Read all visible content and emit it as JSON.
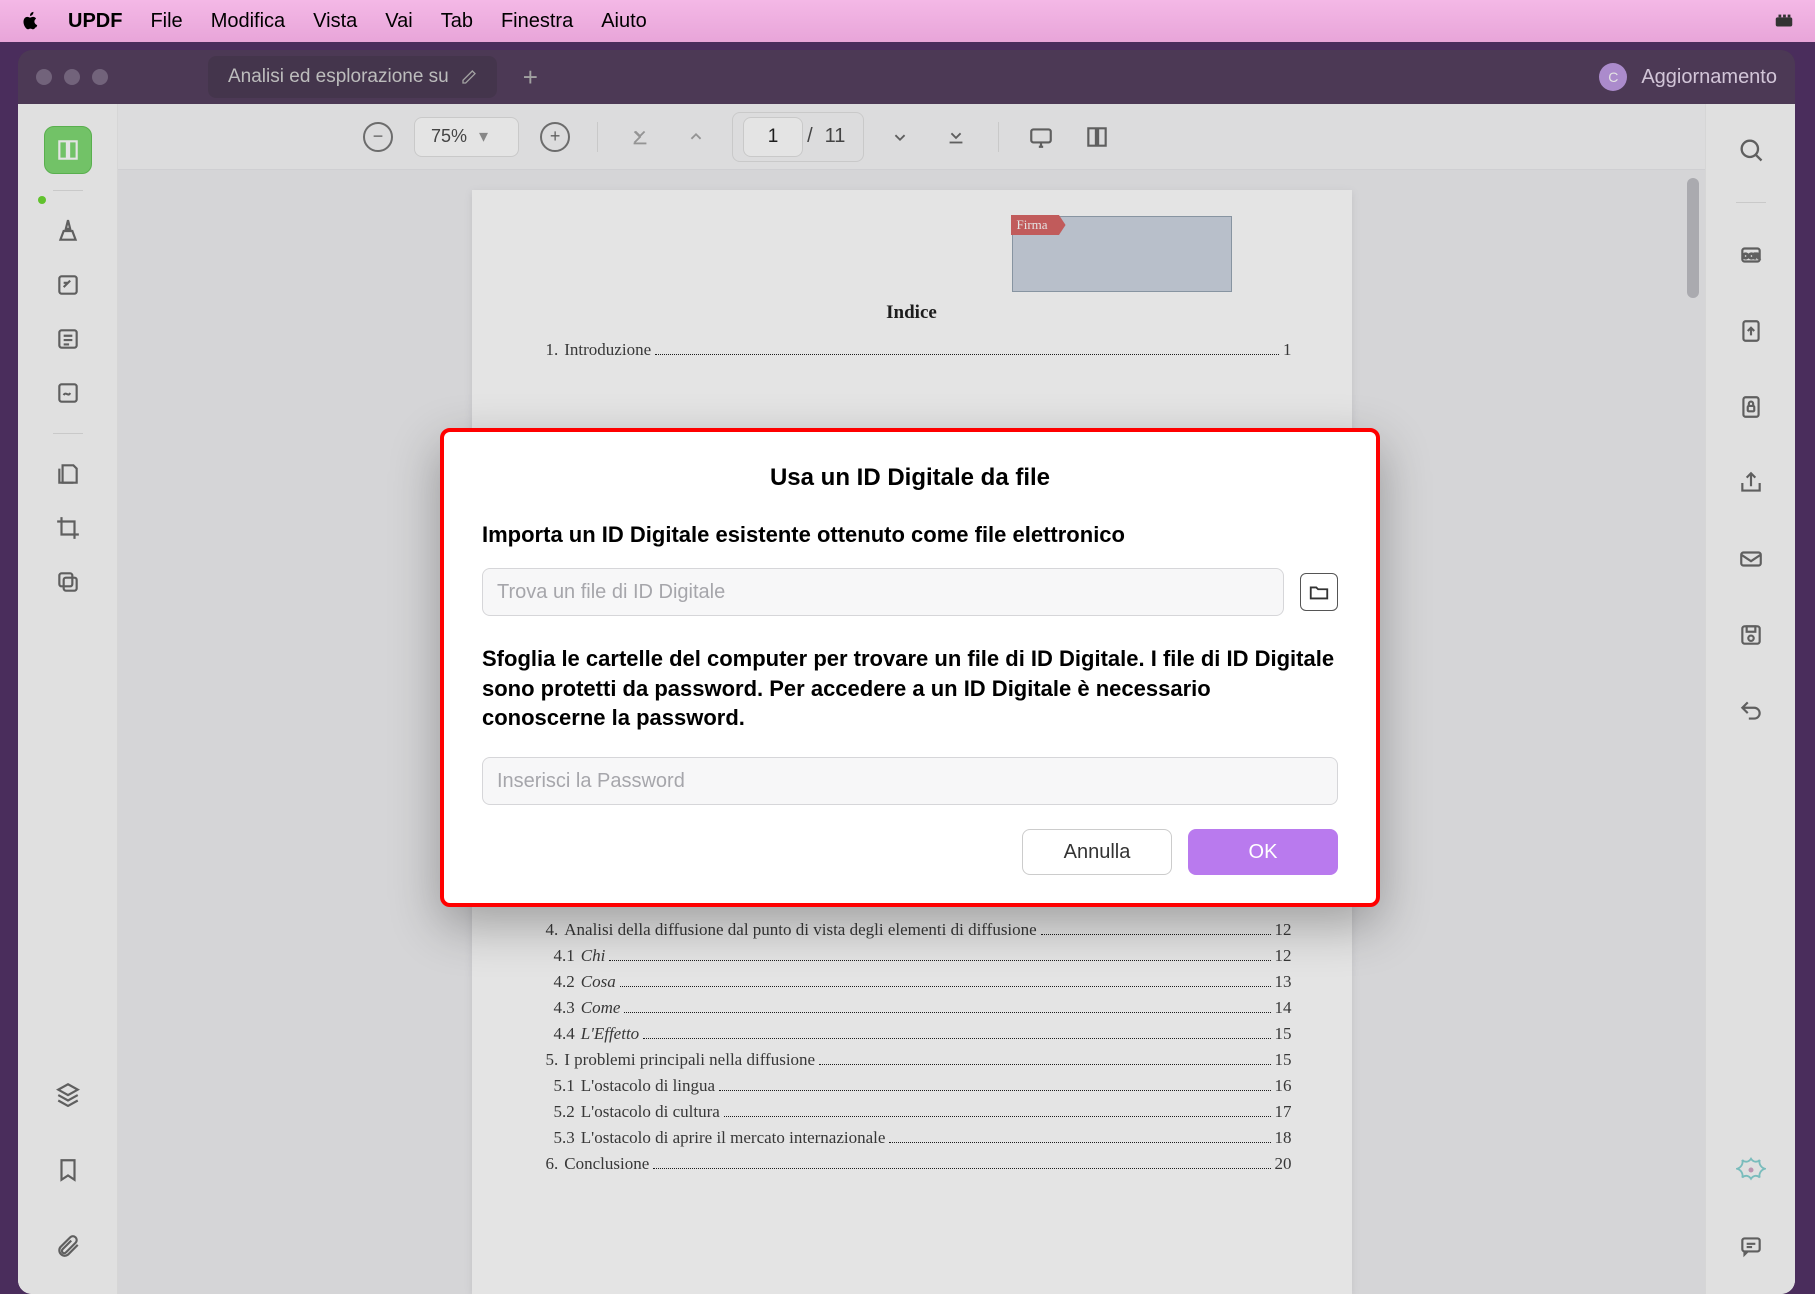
{
  "menubar": {
    "app_name": "UPDF",
    "items": [
      "File",
      "Modifica",
      "Vista",
      "Vai",
      "Tab",
      "Finestra",
      "Aiuto"
    ]
  },
  "window": {
    "tab_title": "Analisi ed esplorazione su",
    "user_initial": "C",
    "update_label": "Aggiornamento"
  },
  "toolbar": {
    "zoom": "75%",
    "page_current": "1",
    "page_total": "11"
  },
  "document": {
    "title": "Indice",
    "firma_label": "Firma",
    "toc": [
      {
        "n": "1.",
        "t": "Introduzione",
        "p": "1",
        "sub": false,
        "it": false
      },
      {
        "n": "4.",
        "t": "Analisi della diffusione dal punto di vista degli elementi di diffusione",
        "p": "12",
        "sub": false,
        "it": false
      },
      {
        "n": "4.1",
        "t": "Chi",
        "p": "12",
        "sub": true,
        "it": true
      },
      {
        "n": "4.2",
        "t": "Cosa",
        "p": "13",
        "sub": true,
        "it": true
      },
      {
        "n": "4.3",
        "t": "Come",
        "p": "14",
        "sub": true,
        "it": true
      },
      {
        "n": "4.4",
        "t": "L'Effetto",
        "p": "15",
        "sub": true,
        "it": true
      },
      {
        "n": "5.",
        "t": "I problemi principali nella diffusione",
        "p": "15",
        "sub": false,
        "it": false
      },
      {
        "n": "5.1",
        "t": "L'ostacolo di lingua",
        "p": "16",
        "sub": true,
        "it": false
      },
      {
        "n": "5.2",
        "t": "L'ostacolo di cultura",
        "p": "17",
        "sub": true,
        "it": false
      },
      {
        "n": "5.3",
        "t": "L'ostacolo di aprire il mercato internazionale",
        "p": "18",
        "sub": true,
        "it": false
      },
      {
        "n": "6.",
        "t": "Conclusione",
        "p": "20",
        "sub": false,
        "it": false
      }
    ]
  },
  "dialog": {
    "title": "Usa un ID Digitale da file",
    "subtitle": "Importa un ID Digitale esistente ottenuto come file elettronico",
    "file_placeholder": "Trova un file di ID Digitale",
    "body_text": "Sfoglia le cartelle del computer per trovare un file di ID Digitale. I file di ID Digitale sono protetti da password. Per accedere a un ID Digitale è necessario conoscerne la password.",
    "password_placeholder": "Inserisci la Password",
    "cancel_label": "Annulla",
    "ok_label": "OK"
  }
}
